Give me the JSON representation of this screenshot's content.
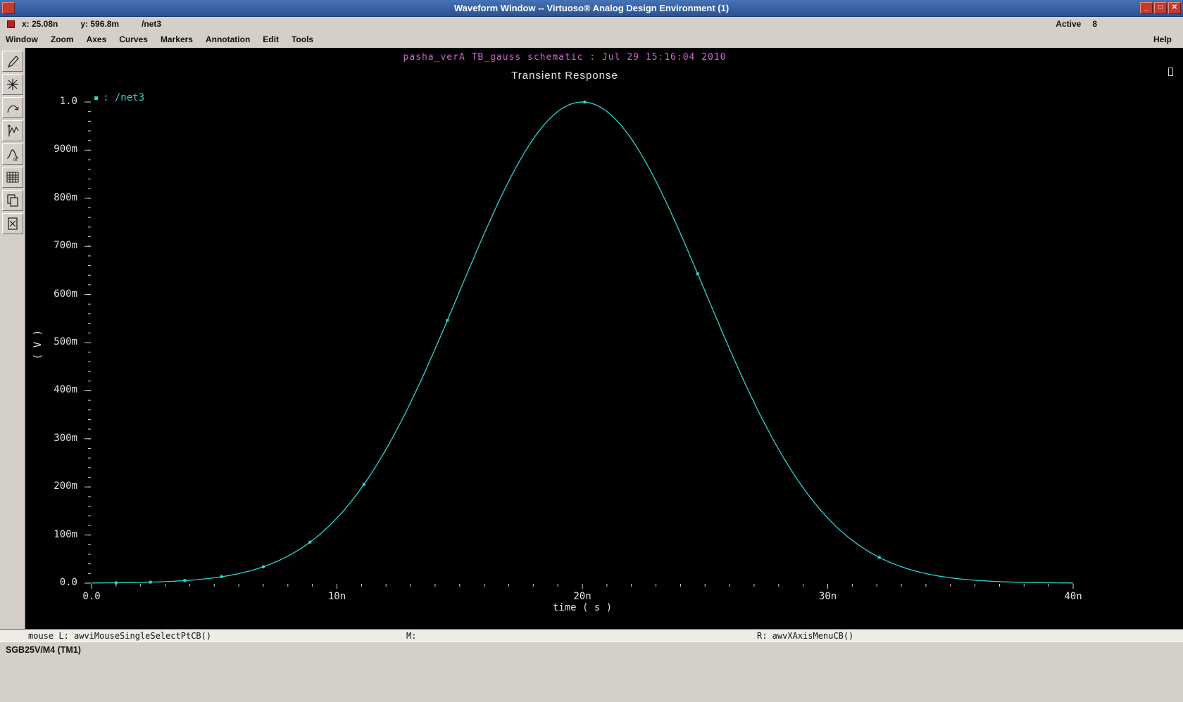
{
  "titlebar": {
    "title": "Waveform Window -- Virtuoso® Analog Design Environment (1)",
    "buttons": {
      "minimize": "_",
      "maximize": "□",
      "close": "✕"
    }
  },
  "status_top": {
    "x_readout": "x: 25.08n",
    "y_readout": "y: 596.8m",
    "net": "/net3",
    "active_label": "Active",
    "active_value": "8"
  },
  "menubar": {
    "items": [
      "Window",
      "Zoom",
      "Axes",
      "Curves",
      "Markers",
      "Annotation",
      "Edit",
      "Tools"
    ],
    "help": "Help"
  },
  "toolbar_icons": [
    "pencil-icon",
    "star-icon",
    "arc-icon",
    "axes-wave-icon",
    "peak-curve-icon",
    "grid-icon",
    "copy-icon",
    "erase-icon"
  ],
  "plot": {
    "header": "pasha_verA TB_gauss schematic : Jul 29 15:16:04 2010",
    "title": "Transient Response",
    "legend_label": ": /net3"
  },
  "chart_data": {
    "type": "line",
    "title": "Transient Response",
    "xlabel": "time ( s )",
    "ylabel": "( V )",
    "xlim_ns": [
      0,
      40
    ],
    "ylim": [
      0,
      1.0
    ],
    "grid": false,
    "legend_position": "top-left",
    "x_ticks": [
      {
        "v": 0,
        "label": "0.0"
      },
      {
        "v": 10,
        "label": "10n"
      },
      {
        "v": 20,
        "label": "20n"
      },
      {
        "v": 30,
        "label": "30n"
      },
      {
        "v": 40,
        "label": "40n"
      }
    ],
    "y_ticks": [
      {
        "v": 0.0,
        "label": "0.0"
      },
      {
        "v": 0.1,
        "label": "100m"
      },
      {
        "v": 0.2,
        "label": "200m"
      },
      {
        "v": 0.3,
        "label": "300m"
      },
      {
        "v": 0.4,
        "label": "400m"
      },
      {
        "v": 0.5,
        "label": "500m"
      },
      {
        "v": 0.6,
        "label": "600m"
      },
      {
        "v": 0.7,
        "label": "700m"
      },
      {
        "v": 0.8,
        "label": "800m"
      },
      {
        "v": 0.9,
        "label": "900m"
      },
      {
        "v": 1.0,
        "label": "1.0"
      }
    ],
    "series": [
      {
        "name": "/net3",
        "color": "#2bd4d4",
        "model": {
          "shape": "gaussian",
          "amplitude": 1.0,
          "mean_ns": 20,
          "sigma_ns": 5
        },
        "x_ns": [
          0,
          1,
          2,
          3,
          4,
          5,
          6,
          7,
          8,
          9,
          10,
          11,
          12,
          13,
          14,
          15,
          16,
          17,
          18,
          19,
          20,
          21,
          22,
          23,
          24,
          25,
          26,
          27,
          28,
          29,
          30,
          31,
          32,
          33,
          34,
          35,
          36,
          37,
          38,
          39,
          40
        ],
        "y": [
          0.000335,
          0.00073,
          0.001533,
          0.003089,
          0.005976,
          0.011109,
          0.019841,
          0.034047,
          0.056135,
          0.088922,
          0.135335,
          0.197899,
          0.278037,
          0.375311,
          0.486752,
          0.606531,
          0.726149,
          0.83527,
          0.923116,
          0.980199,
          1.0,
          0.980199,
          0.923116,
          0.83527,
          0.726149,
          0.606531,
          0.486752,
          0.375311,
          0.278037,
          0.197899,
          0.135335,
          0.088922,
          0.056135,
          0.034047,
          0.019841,
          0.011109,
          0.005976,
          0.003089,
          0.001533,
          0.00073,
          0.000335
        ],
        "marker_x_ns": [
          1.0,
          2.4,
          3.8,
          5.3,
          7.0,
          8.9,
          11.1,
          14.5,
          20.1,
          24.7,
          32.1
        ]
      }
    ]
  },
  "status_bottom": {
    "mouse_left": "mouse L: awviMouseSingleSelectPtCB()",
    "mouse_middle": "M:",
    "mouse_right": "R: awvXAxisMenuCB()"
  },
  "footer": {
    "label": "SGB25V/M4 (TM1)"
  }
}
